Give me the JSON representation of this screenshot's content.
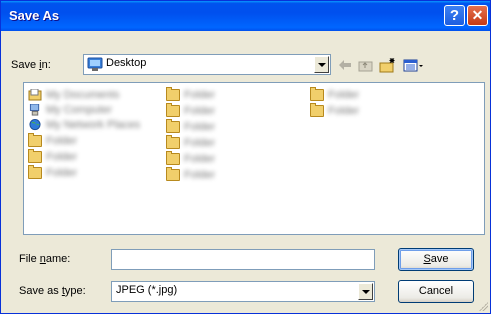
{
  "window": {
    "title": "Save As",
    "help_button": "?",
    "close_button": "✕"
  },
  "location": {
    "label_pre": "Save ",
    "label_u": "i",
    "label_post": "n:",
    "value": "Desktop"
  },
  "toolbar": {
    "back": "back-icon",
    "up": "up-folder-icon",
    "new_folder": "new-folder-icon",
    "view_menu": "view-menu-icon"
  },
  "file_list": {
    "columns": [
      [
        "My Documents",
        "My Computer",
        "My Network Places",
        "Folder",
        "Folder",
        "Folder"
      ],
      [
        "Folder",
        "Folder",
        "Folder",
        "Folder",
        "Folder",
        "Folder"
      ],
      [
        "Folder",
        "Folder"
      ]
    ]
  },
  "filename": {
    "label_pre": "File ",
    "label_u": "n",
    "label_post": "ame:",
    "value": ""
  },
  "filetype": {
    "label_pre": "Save as ",
    "label_u": "t",
    "label_post": "ype:",
    "value": "JPEG (*.jpg)"
  },
  "buttons": {
    "save_u": "S",
    "save_rest": "ave",
    "cancel": "Cancel"
  },
  "colors": {
    "titlebar": "#0053ee",
    "face": "#ece9d8",
    "folder": "#f1cf6b"
  }
}
